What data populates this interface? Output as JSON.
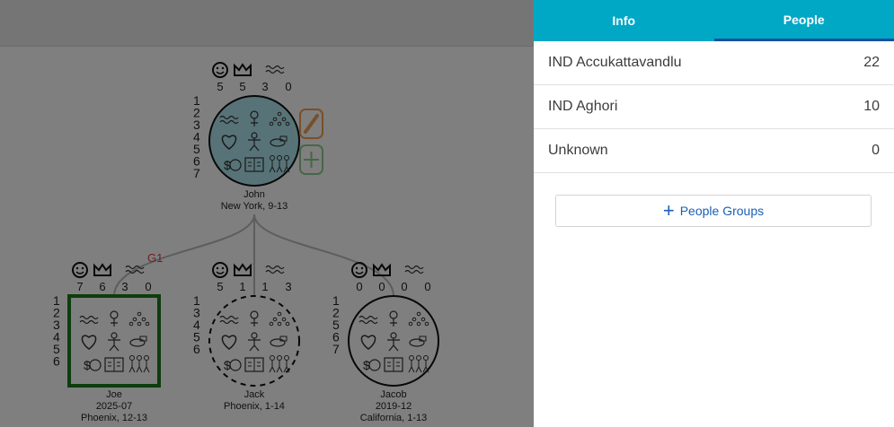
{
  "tree": {
    "nodes": [
      {
        "id": "john",
        "name": "John",
        "line2": "New York, 9-13",
        "line3": "",
        "shape": "circle",
        "border": "solid",
        "fill": "#aee6f0",
        "counts": [
          "5",
          "5",
          "3",
          "0"
        ],
        "levels": [
          "1",
          "2",
          "3",
          "4",
          "5",
          "6",
          "7"
        ]
      },
      {
        "id": "joe",
        "name": "Joe",
        "line2": "2025-07",
        "line3": "Phoenix, 12-13",
        "shape": "square",
        "border": "solid-green",
        "fill": "none",
        "counts": [
          "7",
          "6",
          "3",
          "0"
        ],
        "levels": [
          "1",
          "2",
          "3",
          "4",
          "5",
          "6"
        ]
      },
      {
        "id": "jack",
        "name": "Jack",
        "line2": "Phoenix, 1-14",
        "line3": "",
        "shape": "circle",
        "border": "dashed",
        "fill": "none",
        "counts": [
          "5",
          "1",
          "1",
          "3"
        ],
        "levels": [
          "1",
          "3",
          "4",
          "5",
          "6"
        ]
      },
      {
        "id": "jacob",
        "name": "Jacob",
        "line2": "2019-12",
        "line3": "California, 1-13",
        "shape": "circle",
        "border": "solid",
        "fill": "none",
        "counts": [
          "0",
          "0",
          "0",
          "0"
        ],
        "levels": [
          "1",
          "2",
          "5",
          "6",
          "7"
        ]
      }
    ],
    "generation_label": "G1",
    "icons": [
      "smiley-icon",
      "crown-icon",
      "water-icon"
    ],
    "node_buttons": [
      "edit-icon",
      "add-icon"
    ],
    "colors": {
      "accent": "#00a8c6",
      "green": "#1a7a1a",
      "edit": "#f0a050",
      "add": "#8ccf8c",
      "gen": "#e04040"
    }
  },
  "panel": {
    "tabs": [
      {
        "label": "Info",
        "active": false
      },
      {
        "label": "People",
        "active": true
      }
    ],
    "groups": [
      {
        "name": "IND Accukattavandlu",
        "count": "22"
      },
      {
        "name": "IND Aghori",
        "count": "10"
      },
      {
        "name": "Unknown",
        "count": "0"
      }
    ],
    "add_label": "People Groups"
  }
}
